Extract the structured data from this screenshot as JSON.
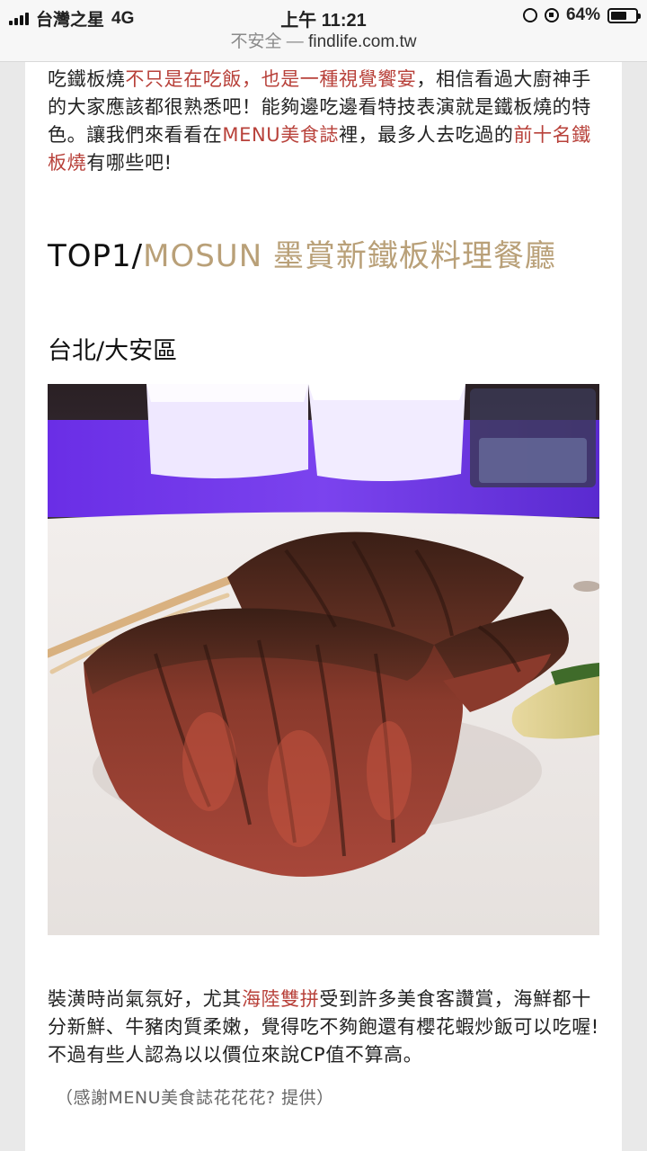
{
  "status_bar": {
    "carrier": "台灣之星",
    "network": "4G",
    "time": "上午 11:21",
    "battery_text": "64%",
    "battery_level": 0.64
  },
  "url_bar": {
    "security_label": "不安全",
    "separator": " — ",
    "domain": "findlife.com.tw"
  },
  "intro": {
    "t1": "吃鐵板燒",
    "t2": "不只是在吃飯，也是一種視覺饗宴",
    "t3": "，相信看過大廚神手的大家應該都很熟悉吧！能夠邊吃邊看特技表演就是鐵板燒的特色。讓我們來看看在",
    "t4": "MENU美食誌",
    "t5": "裡，最多人去吃過的",
    "t6": "前十名鐵板燒",
    "t7": "有哪些吧!"
  },
  "section": {
    "rank": "TOP1/",
    "name": "MOSUN 墨賞新鐵板料理餐廳",
    "location": "台北/大安區"
  },
  "photo": {
    "alt": "sliced steak on plate"
  },
  "description": {
    "d1": "裝潢時尚氣氛好，尤其",
    "d2": "海陸雙拼",
    "d3": "受到許多美食客讚賞，海鮮都十分新鮮、牛豬肉質柔嫩，覺得吃不夠飽還有櫻花蝦炒飯可以吃喔! 不過有些人認為以以價位來說CP值不算高。"
  },
  "credit": "（感謝MENU美食誌花花花? 提供）",
  "colors": {
    "accent_red": "#b8413a",
    "accent_gold": "#b9a078"
  }
}
